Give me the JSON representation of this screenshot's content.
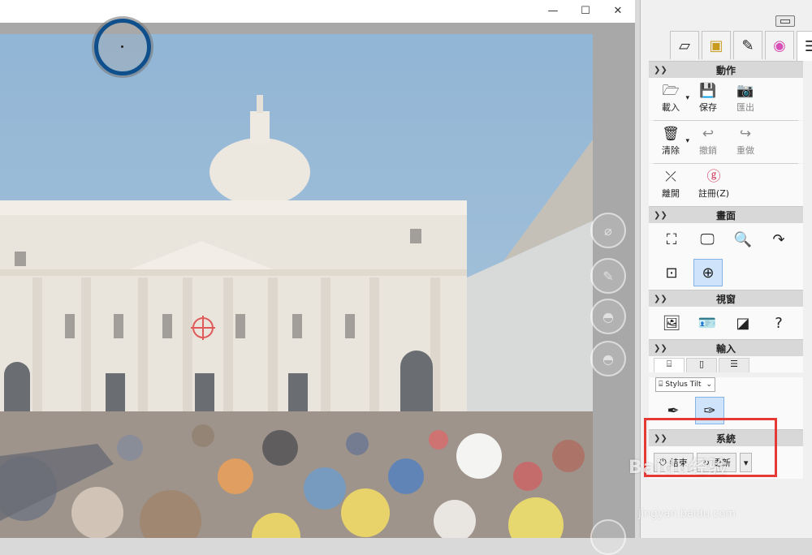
{
  "window": {
    "minimize": "—",
    "maximize": "☐",
    "close": "✕"
  },
  "panel": {
    "tabs": [
      {
        "name": "layers-icon",
        "glyph": "▱"
      },
      {
        "name": "canvas-icon",
        "glyph": "▣"
      },
      {
        "name": "brush-icon",
        "glyph": "✎"
      },
      {
        "name": "color-wheel-icon",
        "glyph": "◉"
      },
      {
        "name": "menu-icon",
        "glyph": "☰"
      }
    ],
    "sections": {
      "actions": {
        "title": "動作",
        "load": "載入",
        "save": "保存",
        "export": "匯出",
        "clear": "清除",
        "undo": "撤銷",
        "redo": "重做",
        "detach": "離開",
        "register": "註冊(Z)"
      },
      "canvas": {
        "title": "畫面"
      },
      "view": {
        "title": "視窗",
        "help_glyph": "?"
      },
      "input": {
        "title": "輸入",
        "device": "Stylus Tilt"
      },
      "system": {
        "title": "系統",
        "quit": "結束",
        "update": "更新"
      }
    }
  },
  "watermark": {
    "brand": "Baidu经验",
    "url": "jingyan.baidu.com"
  },
  "colors": {
    "brush_ring": "#0e4f8c",
    "highlight_box": "#e53935",
    "active_button": "#cfe4fb"
  }
}
